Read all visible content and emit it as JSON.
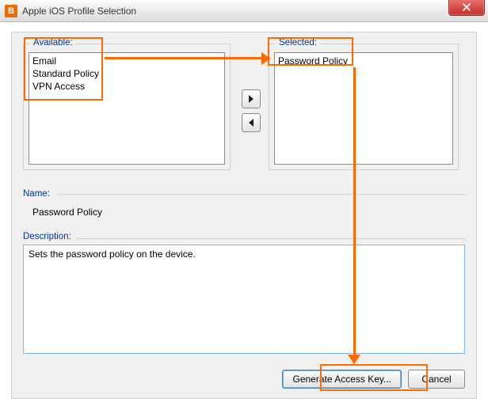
{
  "window": {
    "title": "Apple iOS Profile Selection",
    "app_icon_letter": "B"
  },
  "available": {
    "legend": "Available:",
    "items": [
      "Email",
      "Standard Policy",
      "VPN Access"
    ]
  },
  "selected": {
    "legend": "Selected:",
    "items": [
      "Password Policy"
    ]
  },
  "name": {
    "label": "Name:",
    "value": "Password Policy"
  },
  "description": {
    "label": "Description:",
    "value": "Sets the password policy on the device."
  },
  "buttons": {
    "generate": "Generate Access Key...",
    "cancel": "Cancel"
  }
}
